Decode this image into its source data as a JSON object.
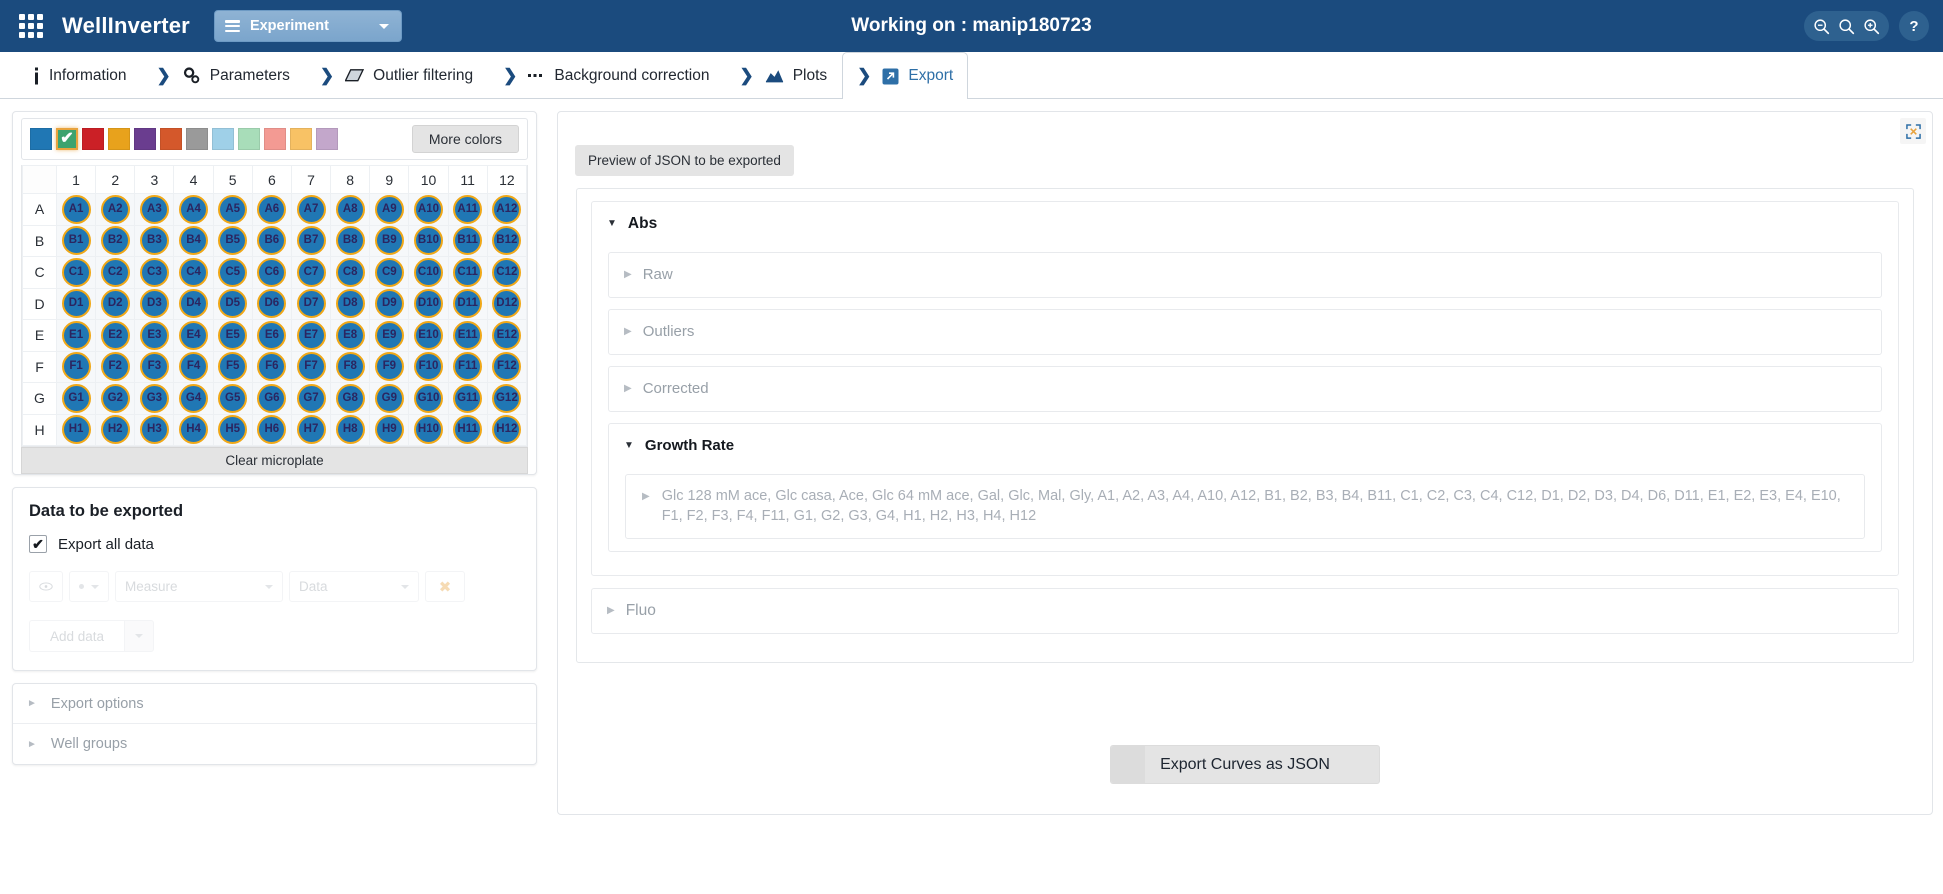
{
  "navbar": {
    "brand": "WellInverter",
    "experiment_button": "Experiment",
    "working_on": "Working on : manip180723",
    "help_label": "?",
    "icons": {
      "apps": "apps-grid-icon",
      "menu": "hamburger-icon",
      "zoom_out": "zoom-out-icon",
      "zoom_reset": "zoom-reset-icon",
      "zoom_in": "zoom-in-icon",
      "help": "help-icon"
    },
    "accent": "#1b4b7e"
  },
  "tabs": [
    {
      "label": "Information",
      "icon": "info-icon",
      "chevron": false,
      "active": false
    },
    {
      "label": "Parameters",
      "icon": "gears-icon",
      "chevron": true,
      "active": false
    },
    {
      "label": "Outlier filtering",
      "icon": "eraser-icon",
      "chevron": true,
      "active": false
    },
    {
      "label": "Background correction",
      "icon": "dots-icon",
      "chevron": true,
      "active": false
    },
    {
      "label": "Plots",
      "icon": "chart-icon",
      "chevron": true,
      "active": false
    },
    {
      "label": "Export",
      "icon": "export-icon",
      "chevron": true,
      "active": true
    }
  ],
  "palette": {
    "more_colors_label": "More colors",
    "selected_index": 1,
    "selected_mark": "✔",
    "colors": [
      "#2077b4",
      "#3da36e",
      "#cb2026",
      "#e8a21c",
      "#6a3d8f",
      "#d4582b",
      "#9a9a9a",
      "#9fd0e8",
      "#a8ddb9",
      "#f39a93",
      "#f8c265",
      "#c3a7cb"
    ]
  },
  "microplate": {
    "columns": [
      "1",
      "2",
      "3",
      "4",
      "5",
      "6",
      "7",
      "8",
      "9",
      "10",
      "11",
      "12"
    ],
    "rows": [
      "A",
      "B",
      "C",
      "D",
      "E",
      "F",
      "G",
      "H"
    ],
    "well_fill": "#2077b4",
    "well_border": "#f0a818",
    "well_text": "#2b2560",
    "clear_label": "Clear microplate"
  },
  "data_panel": {
    "title": "Data to be exported",
    "export_all_label": "Export all data",
    "export_all_checked": true,
    "checkmark": "✔",
    "eye_icon": "eye-icon",
    "measure_placeholder": "Measure",
    "data_placeholder": "Data",
    "remove_icon": "✖",
    "add_data_label": "Add data"
  },
  "left_accordions": [
    {
      "label": "Export options"
    },
    {
      "label": "Well groups"
    }
  ],
  "preview": {
    "expand_icon": "expand-arrows-icon",
    "tab_label": "Preview of JSON to be exported",
    "tree": [
      {
        "label": "Abs",
        "open": true,
        "children": [
          {
            "label": "Raw",
            "open": false
          },
          {
            "label": "Outliers",
            "open": false
          },
          {
            "label": "Corrected",
            "open": false
          },
          {
            "label": "Growth Rate",
            "open": true,
            "leaf": "Glc 128 mM ace, Glc casa, Ace, Glc 64 mM ace, Gal, Glc, Mal, Gly, A1, A2, A3, A4, A10, A12, B1, B2, B3, B4, B11, C1, C2, C3, C4, C12, D1, D2, D3, D4, D6, D11, E1, E2, E3, E4, E10, F1, F2, F3, F4, F11, G1, G2, G3, G4, H1, H2, H3, H4, H12"
          }
        ]
      },
      {
        "label": "Fluo",
        "open": false,
        "children": []
      }
    ],
    "export_button": "Export Curves as JSON"
  }
}
